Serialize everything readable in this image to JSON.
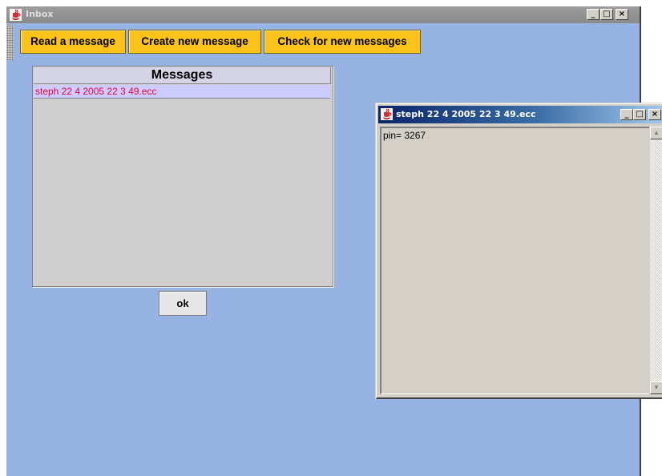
{
  "main_window": {
    "title": "Inbox",
    "icon": "java-cup-icon",
    "controls": {
      "minimize": "_",
      "maximize": "□",
      "close": "×"
    },
    "toolbar": {
      "read_label": "Read a message",
      "create_label": "Create new message",
      "check_label": "Check for new messages"
    },
    "messages": {
      "header": "Messages",
      "items": [
        "steph 22 4 2005 22 3 49.ecc"
      ]
    },
    "ok_label": "ok"
  },
  "message_window": {
    "title": "steph 22 4 2005 22 3 49.ecc",
    "icon": "java-cup-icon",
    "controls": {
      "minimize": "_",
      "maximize": "□",
      "close": "×"
    },
    "content": "pin= 3267"
  },
  "colors": {
    "desktop": "#96b3e4",
    "toolbar_button": "#fbc31a",
    "message_text": "#e8003a",
    "selected_row": "#ccccff",
    "active_title_start": "#0a246a",
    "active_title_end": "#a6caf0"
  }
}
